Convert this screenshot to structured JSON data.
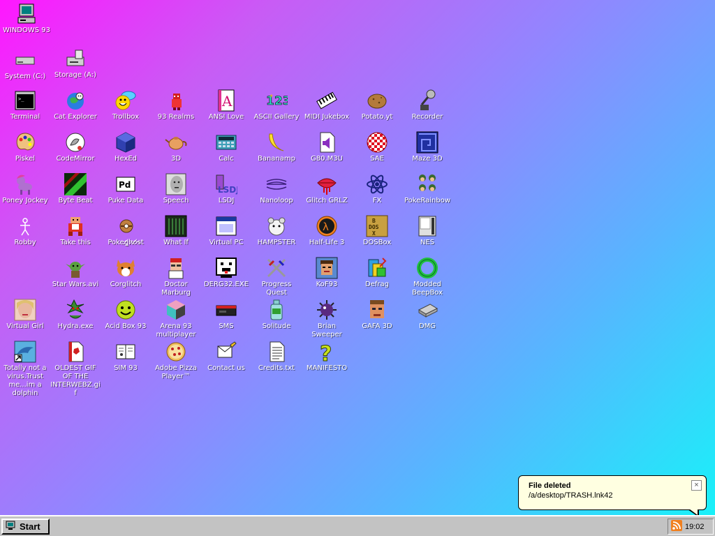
{
  "desktop": {
    "icons": {
      "windows93": {
        "label": "WINDOWS 93",
        "icon": "computer-icon"
      },
      "system_c": {
        "label": "System (C:)",
        "icon": "drive-icon"
      },
      "storage_a": {
        "label": "Storage (A:)",
        "icon": "floppy-drive-icon"
      },
      "terminal": {
        "label": "Terminal",
        "icon": "terminal-icon"
      },
      "cat_explorer": {
        "label": "Cat Explorer",
        "icon": "cat-globe-icon"
      },
      "trollbox": {
        "label": "Trollbox",
        "icon": "chat-icon"
      },
      "realms": {
        "label": "93 Realms",
        "icon": "knight-icon"
      },
      "ansi_love": {
        "label": "ANSI Love",
        "icon": "letter-a-icon"
      },
      "ascii_gallery": {
        "label": "ASCII Gallery",
        "icon": "numbers-icon"
      },
      "midi_jukebox": {
        "label": "MIDI Jukebox",
        "icon": "piano-icon"
      },
      "potato": {
        "label": "Potato.yt",
        "icon": "potato-icon"
      },
      "recorder": {
        "label": "Recorder",
        "icon": "microphone-icon"
      },
      "piskel": {
        "label": "Piskel",
        "icon": "palette-icon"
      },
      "codemirror": {
        "label": "CodeMirror",
        "icon": "codemirror-icon"
      },
      "hexed": {
        "label": "HexEd",
        "icon": "cube-icon"
      },
      "threed": {
        "label": "3D",
        "icon": "teapot-icon"
      },
      "calc": {
        "label": "Calc",
        "icon": "calculator-icon"
      },
      "bananamp": {
        "label": "Bananamp",
        "icon": "banana-icon"
      },
      "g80": {
        "label": "G80.M3U",
        "icon": "audio-file-icon"
      },
      "sae": {
        "label": "SAE",
        "icon": "amiga-ball-icon"
      },
      "maze3d": {
        "label": "Maze 3D",
        "icon": "maze-icon"
      },
      "poney": {
        "label": "Poney Jockey",
        "icon": "pony-icon"
      },
      "bytebeat": {
        "label": "Byte Beat",
        "icon": "bytebeat-icon"
      },
      "pukedata": {
        "label": "Puke Data",
        "icon": "pd-icon"
      },
      "speech": {
        "label": "Speech",
        "icon": "face-icon"
      },
      "lsdj": {
        "label": "LSDJ",
        "icon": "lsdj-icon"
      },
      "nanoloop": {
        "label": "Nanoloop",
        "icon": "wave-icon"
      },
      "glitchgrlz": {
        "label": "Glitch GRLZ",
        "icon": "lips-icon"
      },
      "fx": {
        "label": "FX",
        "icon": "atom-icon"
      },
      "pokerainbow": {
        "label": "PokeRainbow",
        "icon": "trainers-icon"
      },
      "robby": {
        "label": "Robby",
        "icon": "stickman-icon"
      },
      "takethis": {
        "label": "Take this",
        "icon": "old-man-icon"
      },
      "pokeghost": {
        "label": "Pokeg̸̢h̷o̸s̴t",
        "icon": "pokeball-icon"
      },
      "whatif": {
        "label": "What If",
        "icon": "whatif-icon"
      },
      "virtualpc": {
        "label": "Virtual PC",
        "icon": "window-icon"
      },
      "hampster": {
        "label": "HAMPSTER",
        "icon": "hamster-icon"
      },
      "halflife3": {
        "label": "Half-Life 3",
        "icon": "lambda-icon"
      },
      "dosbox": {
        "label": "DOSBox",
        "icon": "dosbox-icon"
      },
      "nes": {
        "label": "NES",
        "icon": "nes-icon"
      },
      "starwars": {
        "label": "Star Wars.avi",
        "icon": "yoda-icon"
      },
      "corglitch": {
        "label": "Corglitch",
        "icon": "corgi-icon"
      },
      "marburg": {
        "label": "Doctor Marburg",
        "icon": "doctor-icon"
      },
      "derg32": {
        "label": "DERG32.EXE",
        "icon": "derg-icon"
      },
      "progressquest": {
        "label": "Progress Quest",
        "icon": "swords-icon"
      },
      "kof93": {
        "label": "KoF93",
        "icon": "fighter-icon"
      },
      "defrag": {
        "label": "Defrag",
        "icon": "defrag-icon"
      },
      "beepbox": {
        "label": "Modded BeepBox",
        "icon": "ring-icon"
      },
      "virtualgirl": {
        "label": "Virtual Girl",
        "icon": "girl-icon"
      },
      "hydra": {
        "label": "Hydra.exe",
        "icon": "hydra-icon"
      },
      "acidbox": {
        "label": "Acid Box 93",
        "icon": "smiley-icon"
      },
      "arena93": {
        "label": "Arena 93 multiplayer",
        "icon": "arena-cube-icon"
      },
      "sms": {
        "label": "SMS",
        "icon": "console-icon"
      },
      "solitude": {
        "label": "Solitude",
        "icon": "bottle-icon"
      },
      "sweeper": {
        "label": "Brian Sweeper",
        "icon": "mine-icon"
      },
      "gafa3d": {
        "label": "GAFA 3D",
        "icon": "doomguy-icon"
      },
      "dmg": {
        "label": "DMG",
        "icon": "disk-image-icon"
      },
      "dolphin": {
        "label": "Totally not a virus.Trust me...im a dolphin",
        "icon": "dolphin-icon"
      },
      "oldestgif": {
        "label": "OLDEST GIF OF THE INTERWEBZ.gif",
        "icon": "gif-file-icon"
      },
      "sim93": {
        "label": "SIM 93",
        "icon": "book-icon"
      },
      "pizza": {
        "label": "Adobe Pizza Player™",
        "icon": "pizza-icon"
      },
      "contact": {
        "label": "Contact us",
        "icon": "letter-icon"
      },
      "credits": {
        "label": "Credits.txt",
        "icon": "text-file-icon"
      },
      "manifesto": {
        "label": "MANIFESTO",
        "icon": "question-icon"
      }
    }
  },
  "notification": {
    "title": "File deleted",
    "message": "/a/desktop/TRASH.lnk42",
    "close_glyph": "×"
  },
  "taskbar": {
    "start_label": "Start",
    "clock": "19:02"
  },
  "colors": {
    "gradient_start": "#ff17ff",
    "gradient_end": "#15f5f8",
    "taskbar": "#c3c3c3",
    "balloon": "#ffffe1"
  }
}
